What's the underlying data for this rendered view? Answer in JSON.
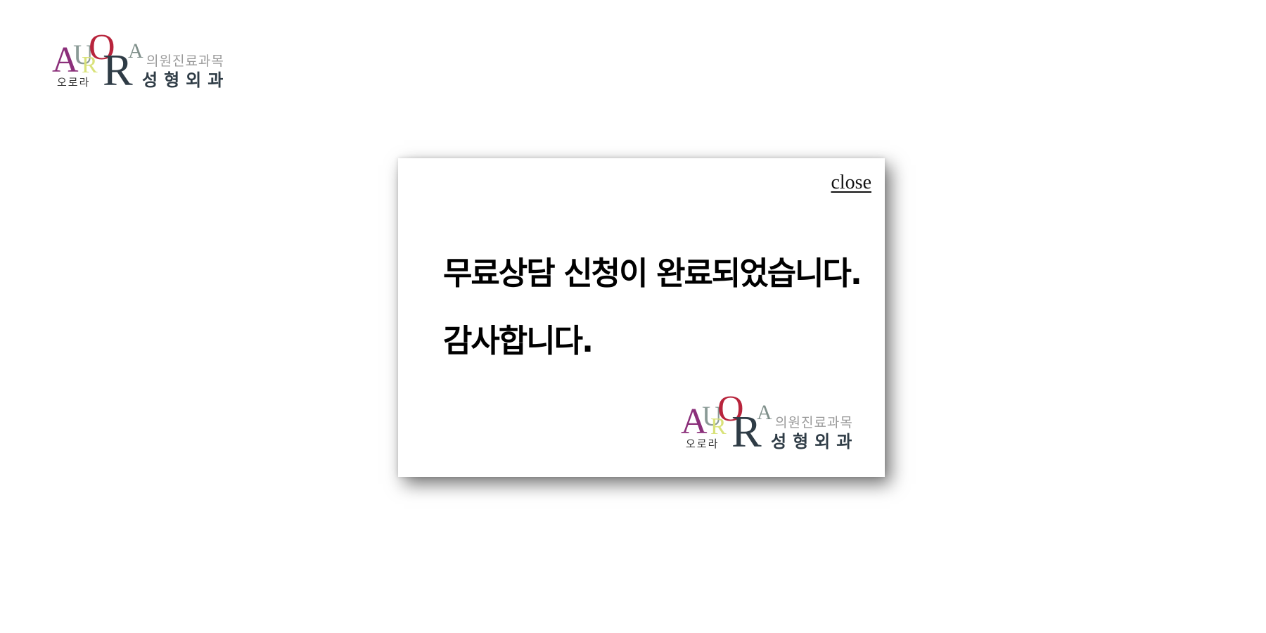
{
  "logo": {
    "letters": [
      "A",
      "U",
      "R",
      "O",
      "R",
      "A"
    ],
    "korean_small": "오로라",
    "korean_sub": "의원진료과목",
    "korean_main": "성형외과",
    "colors": {
      "a1": "#8b2f7a",
      "u": "#8a9a96",
      "r1": "#d9e27a",
      "o": "#b8243c",
      "r2": "#2f3c46",
      "a2": "#7f8f8a",
      "korean_small": "#333333",
      "korean_sub": "#9a9a9a",
      "korean_main": "#2f3c46"
    }
  },
  "modal": {
    "close_label": "close",
    "message_line1": "무료상담 신청이 완료되었습니다.",
    "message_line2": "감사합니다."
  }
}
